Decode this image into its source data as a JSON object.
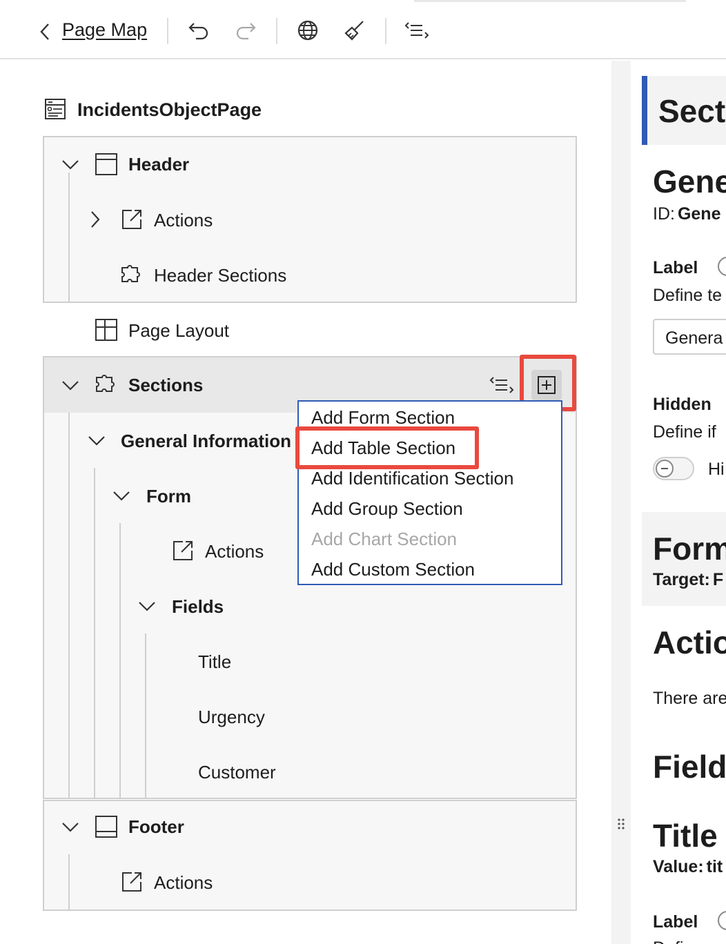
{
  "toolbar": {
    "back_label": "Page Map"
  },
  "tree": {
    "page_title": "IncidentsObjectPage",
    "header": {
      "label": "Header",
      "actions": "Actions",
      "header_sections": "Header Sections"
    },
    "page_layout": "Page Layout",
    "sections": {
      "label": "Sections",
      "general_information": "General Information",
      "form": "Form",
      "form_actions": "Actions",
      "fields": "Fields",
      "field_items": [
        "Title",
        "Urgency",
        "Customer"
      ]
    },
    "footer": {
      "label": "Footer",
      "actions": "Actions"
    }
  },
  "add_section_menu": {
    "items": [
      {
        "label": "Add Form Section",
        "enabled": true
      },
      {
        "label": "Add Table Section",
        "enabled": true,
        "highlighted": true
      },
      {
        "label": "Add Identification Section",
        "enabled": true
      },
      {
        "label": "Add Group Section",
        "enabled": true
      },
      {
        "label": "Add Chart Section",
        "enabled": false
      },
      {
        "label": "Add Custom Section",
        "enabled": true
      }
    ]
  },
  "right_pane": {
    "section_title": "Sect",
    "group_title": "Gene",
    "id_label": "ID:",
    "id_value": "Gene",
    "label_heading": "Label",
    "label_desc": "Define te",
    "label_input_value": "Genera",
    "hidden_heading": "Hidden",
    "hidden_desc": "Define if",
    "hidden_toggle_label": "Hi",
    "form_title": "Form",
    "target_label": "Target:",
    "target_value": "F",
    "actions_title": "Actio",
    "actions_desc": "There are",
    "fields_title": "Field",
    "title_heading": "Title",
    "value_label": "Value:",
    "value_value": "tit",
    "label_heading_2": "Label",
    "label_desc_2": "Defi"
  },
  "colors": {
    "accent_blue": "#2f5bb5",
    "highlight_red": "#e9493e",
    "panel_bg": "#f7f7f7",
    "selected_row_bg": "#e8e8e8"
  }
}
